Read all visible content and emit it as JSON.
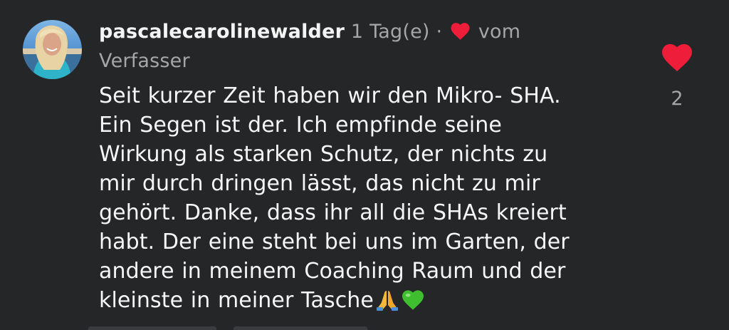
{
  "comment": {
    "username": "pascalecarolinewalder",
    "time": "1 Tag(e)",
    "separator": "·",
    "liked_by_label_part1": "vom",
    "liked_by_label_part2": "Verfasser",
    "body_lines": [
      "Seit kurzer Zeit haben wir den Mikro- SHA.",
      "Ein Segen ist der. Ich empfinde seine",
      "Wirkung als starken Schutz, der nichts zu",
      "mir durch dringen lässt, das nicht zu mir",
      "gehört. Danke, dass ihr all die SHAs kreiert",
      "habt. Der eine steht bei uns im Garten, der",
      "andere in meinem Coaching Raum und der",
      "kleinste in meiner Tasche"
    ],
    "like_count": "2",
    "icons": {
      "author_like": "heart-icon",
      "like_button": "heart-icon",
      "emoji_1": "folded-hands-emoji",
      "emoji_2": "green-heart-emoji"
    }
  },
  "colors": {
    "background": "#242628",
    "heart": "#ee1d3a",
    "muted_text": "#a6a6a6",
    "green_heart": "#3fbf2f"
  }
}
